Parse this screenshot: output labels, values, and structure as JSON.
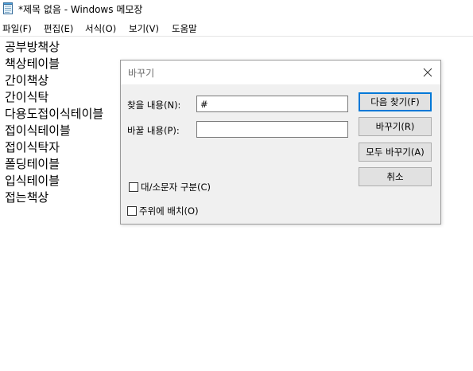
{
  "window": {
    "title": "*제목 없음 - Windows 메모장",
    "icon": "notepad-icon"
  },
  "menu": {
    "file": "파일(F)",
    "edit": "편집(E)",
    "format": "서식(O)",
    "view": "보기(V)",
    "help": "도움말"
  },
  "editor": {
    "lines": [
      "공부방책상",
      "책상테이블",
      "간이책상",
      "간이식탁",
      "다용도접이식테이블",
      "접이식테이블",
      "접이식탁자",
      "폴딩테이블",
      "입식테이블",
      "접는책상"
    ]
  },
  "dialog": {
    "title": "바꾸기",
    "find_label": "찾을 내용(N):",
    "find_value": "#",
    "replace_label": "바꿀 내용(P):",
    "replace_value": "",
    "buttons": {
      "find_next": "다음 찾기(F)",
      "replace": "바꾸기(R)",
      "replace_all": "모두 바꾸기(A)",
      "cancel": "취소"
    },
    "match_case": {
      "label": "대/소문자 구분(C)",
      "checked": false
    },
    "wrap_around": {
      "label": "주위에 배치(O)",
      "checked": false
    }
  },
  "colors": {
    "dialog_bg": "#f0f0f0",
    "button_bg": "#e1e1e1",
    "default_button_border": "#0078d7",
    "title_text": "#6d6d6d"
  }
}
